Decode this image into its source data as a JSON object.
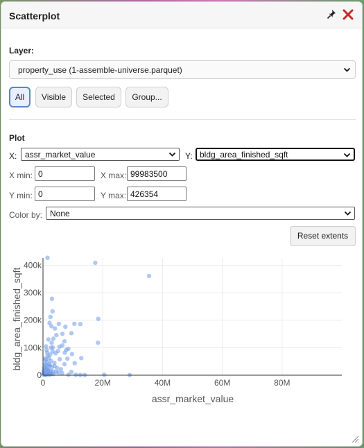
{
  "window": {
    "title": "Scatterplot"
  },
  "layer": {
    "label": "Layer:",
    "selected": "property_use (1-assemble-universe.parquet)"
  },
  "filter_buttons": [
    {
      "label": "All",
      "active": true
    },
    {
      "label": "Visible",
      "active": false
    },
    {
      "label": "Selected",
      "active": false
    },
    {
      "label": "Group...",
      "active": false
    }
  ],
  "plot": {
    "heading": "Plot",
    "x_label": "X:",
    "x_field": "assr_market_value",
    "y_label": "Y:",
    "y_field": "bldg_area_finished_sqft",
    "xmin_label": "X min:",
    "xmin_value": "0",
    "xmax_label": "X max:",
    "xmax_value": "99983500",
    "ymin_label": "Y min:",
    "ymin_value": "0",
    "ymax_label": "Y max:",
    "ymax_value": "426354",
    "colorby_label": "Color by:",
    "colorby_value": "None",
    "reset_label": "Reset extents"
  },
  "chart_data": {
    "type": "scatter",
    "xlabel": "assr_market_value",
    "ylabel": "bldg_area_finished_sqft",
    "xlim": [
      0,
      99983500
    ],
    "ylim": [
      0,
      426354
    ],
    "x_ticks": [
      {
        "value": 0,
        "label": "0"
      },
      {
        "value": 20000000,
        "label": "20M"
      },
      {
        "value": 40000000,
        "label": "40M"
      },
      {
        "value": 60000000,
        "label": "60M"
      },
      {
        "value": 80000000,
        "label": "80M"
      }
    ],
    "y_ticks": [
      {
        "value": 0,
        "label": "0"
      },
      {
        "value": 100000,
        "label": "100k"
      },
      {
        "value": 200000,
        "label": "200k"
      },
      {
        "value": 300000,
        "label": "300k"
      },
      {
        "value": 400000,
        "label": "400k"
      }
    ],
    "grid": true,
    "color": "#6f9be8",
    "points": [
      [
        17500000,
        409000
      ],
      [
        35500000,
        361000
      ],
      [
        1500000,
        427000
      ],
      [
        3000000,
        278000
      ],
      [
        3200000,
        232000
      ],
      [
        2500000,
        212000
      ],
      [
        2200000,
        190000
      ],
      [
        5300000,
        187000
      ],
      [
        10500000,
        187000
      ],
      [
        12500000,
        186000
      ],
      [
        18500000,
        205000
      ],
      [
        7500000,
        176000
      ],
      [
        2800000,
        178000
      ],
      [
        4000000,
        170000
      ],
      [
        9500000,
        153000
      ],
      [
        6500000,
        150000
      ],
      [
        4500000,
        146000
      ],
      [
        3500000,
        133000
      ],
      [
        1800000,
        130000
      ],
      [
        7200000,
        123000
      ],
      [
        18400000,
        118000
      ],
      [
        6500000,
        108000
      ],
      [
        5500000,
        104000
      ],
      [
        3300000,
        101000
      ],
      [
        2700000,
        100000
      ],
      [
        8500000,
        96000
      ],
      [
        7800000,
        92000
      ],
      [
        5000000,
        88000
      ],
      [
        3200000,
        86000
      ],
      [
        1200000,
        92000
      ],
      [
        7300000,
        82000
      ],
      [
        4200000,
        80000
      ],
      [
        9700000,
        77000
      ],
      [
        2400000,
        75000
      ],
      [
        12800000,
        62000
      ],
      [
        8200000,
        60000
      ],
      [
        5600000,
        58000
      ],
      [
        10600000,
        44000
      ],
      [
        7200000,
        40000
      ],
      [
        3800000,
        45000
      ],
      [
        1500000,
        70000
      ],
      [
        2000000,
        62000
      ],
      [
        900000,
        55000
      ],
      [
        1300000,
        48000
      ],
      [
        2600000,
        52000
      ],
      [
        600000,
        40000
      ],
      [
        1000000,
        36000
      ],
      [
        1700000,
        32000
      ],
      [
        2300000,
        35000
      ],
      [
        3000000,
        30000
      ],
      [
        500000,
        28000
      ],
      [
        800000,
        25000
      ],
      [
        1200000,
        22000
      ],
      [
        1600000,
        20000
      ],
      [
        2000000,
        18000
      ],
      [
        2600000,
        16000
      ],
      [
        3400000,
        14000
      ],
      [
        4400000,
        12000
      ],
      [
        5200000,
        10000
      ],
      [
        6400000,
        8000
      ],
      [
        300000,
        18000
      ],
      [
        700000,
        15000
      ],
      [
        1100000,
        12000
      ],
      [
        1500000,
        10000
      ],
      [
        1900000,
        8000
      ],
      [
        2400000,
        6000
      ],
      [
        2900000,
        5000
      ],
      [
        3500000,
        4000
      ],
      [
        200000,
        9000
      ],
      [
        500000,
        7000
      ],
      [
        900000,
        5000
      ],
      [
        1300000,
        4000
      ],
      [
        1800000,
        3000
      ],
      [
        2300000,
        2000
      ],
      [
        100000,
        3000
      ],
      [
        400000,
        2000
      ],
      [
        700000,
        1500
      ],
      [
        1000000,
        1000
      ],
      [
        8500000,
        1500
      ],
      [
        11000000,
        1200
      ],
      [
        12500000,
        800
      ],
      [
        14000000,
        500
      ],
      [
        20500000,
        1200
      ],
      [
        29000000,
        600
      ],
      [
        9500000,
        12000
      ],
      [
        6000000,
        22000
      ],
      [
        4700000,
        26000
      ],
      [
        3900000,
        33000
      ],
      [
        2100000,
        40000
      ],
      [
        600000,
        60000
      ],
      [
        1400000,
        82000
      ],
      [
        2900000,
        118000
      ],
      [
        1000000,
        105000
      ]
    ]
  }
}
